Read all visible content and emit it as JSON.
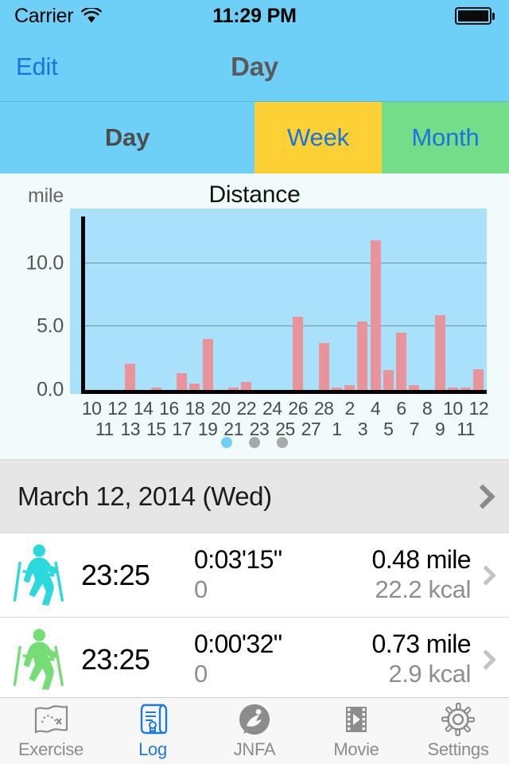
{
  "status_bar": {
    "carrier": "Carrier",
    "wifi_icon": "wifi-icon",
    "time": "11:29 PM",
    "battery_icon": "battery-full-icon"
  },
  "nav_bar": {
    "edit_label": "Edit",
    "title": "Day"
  },
  "segmented_control": {
    "segments": [
      {
        "label": "Day",
        "selected": true,
        "bg": "#6ed0f6",
        "fg": "#4d4d4d"
      },
      {
        "label": "Week",
        "selected": false,
        "bg": "#fdd033",
        "fg": "#1a74df"
      },
      {
        "label": "Month",
        "selected": false,
        "bg": "#74dd8a",
        "fg": "#1a74df"
      }
    ]
  },
  "chart_data": {
    "type": "bar",
    "title": "Distance",
    "ylabel": "mile",
    "xlabel": "",
    "unit": "mile",
    "ylim": [
      0,
      14
    ],
    "yticks": [
      0.0,
      5.0,
      10.0
    ],
    "ytick_labels": [
      "0.0",
      "5.0",
      "10.0"
    ],
    "grid": true,
    "legend": "none",
    "bar_color": "#e8949a",
    "plot_bg": "#a9e0fa",
    "categories": [
      "10",
      "11",
      "12",
      "13",
      "14",
      "15",
      "16",
      "17",
      "18",
      "19",
      "20",
      "21",
      "22",
      "23",
      "24",
      "25",
      "26",
      "27",
      "28",
      "1",
      "2",
      "3",
      "4",
      "5",
      "6",
      "7",
      "8",
      "9",
      "10",
      "11",
      "12"
    ],
    "values": [
      0,
      0,
      0,
      2.1,
      0,
      0.12,
      0,
      1.3,
      0.5,
      4.0,
      0,
      0.08,
      0.6,
      0,
      0,
      0,
      5.8,
      0,
      3.7,
      0.1,
      0.4,
      5.4,
      11.8,
      1.6,
      4.5,
      0.4,
      0,
      5.9,
      0.15,
      0.1,
      1.65
    ],
    "x_tick_rows": {
      "top": [
        "10",
        "12",
        "14",
        "16",
        "18",
        "20",
        "22",
        "24",
        "26",
        "28",
        "2",
        "4",
        "6",
        "8",
        "10",
        "12"
      ],
      "bottom": [
        "11",
        "13",
        "15",
        "17",
        "19",
        "21",
        "23",
        "25",
        "27",
        "1",
        "3",
        "5",
        "7",
        "9",
        "11"
      ]
    }
  },
  "page_indicator": {
    "count": 3,
    "active_index": 0,
    "active_color": "#6ed0f6",
    "inactive_color": "#a8a8a8"
  },
  "date_header": {
    "label": "March 12, 2014 (Wed)",
    "chevron_icon": "chevron-right-icon"
  },
  "activity_list": {
    "rows": [
      {
        "icon": "nordic-walking-icon",
        "icon_color": "#2ad9dd",
        "time": "23:25",
        "duration": "0:03'15\"",
        "steps": "0",
        "distance": "0.48 mile",
        "calories": "22.2 kcal",
        "chevron_icon": "chevron-right-icon"
      },
      {
        "icon": "nordic-walking-icon",
        "icon_color": "#74dd74",
        "time": "23:25",
        "duration": "0:00'32\"",
        "steps": "0",
        "distance": "0.73 mile",
        "calories": "2.9 kcal",
        "chevron_icon": "chevron-right-icon"
      }
    ]
  },
  "tab_bar": {
    "active_index": 1,
    "active_color": "#1a7ae8",
    "inactive_color": "#8c8c8c",
    "items": [
      {
        "label": "Exercise",
        "icon": "map-route-icon"
      },
      {
        "label": "Log",
        "icon": "scroll-log-icon"
      },
      {
        "label": "JNFA",
        "icon": "jnfa-logo-icon"
      },
      {
        "label": "Movie",
        "icon": "film-play-icon"
      },
      {
        "label": "Settings",
        "icon": "gear-icon"
      }
    ]
  }
}
